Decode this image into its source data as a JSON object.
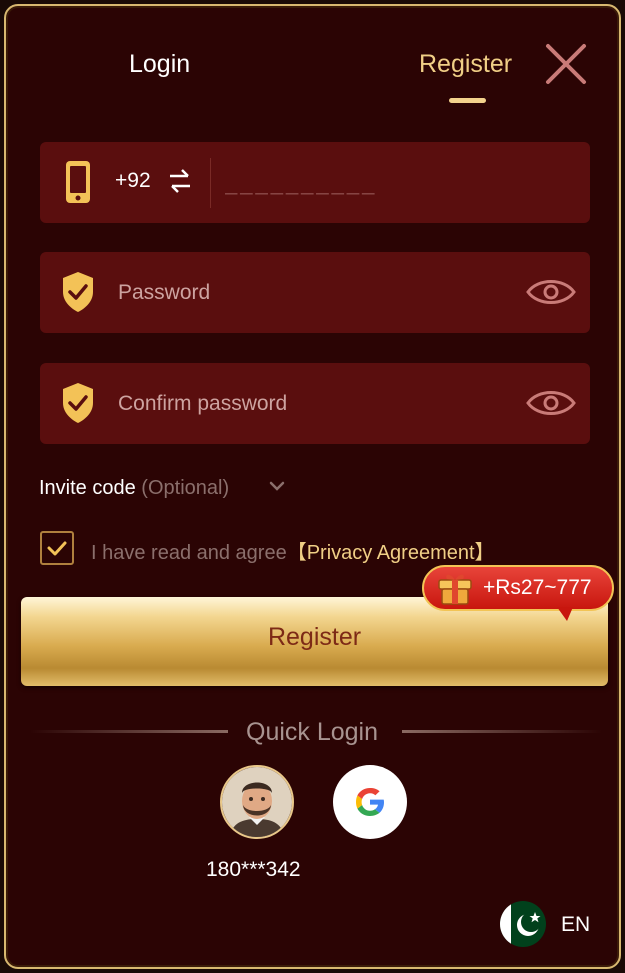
{
  "tabs": {
    "login": "Login",
    "register": "Register",
    "active": "register"
  },
  "icons": {
    "close": "close-icon",
    "phone": "phone-icon",
    "swap": "swap-icon",
    "shield": "shield-check-icon",
    "eye": "eye-icon",
    "chevron": "chevron-down-icon",
    "check": "check-icon",
    "gift": "gift-box-icon",
    "google": "google-icon"
  },
  "phone": {
    "country_code": "+92",
    "placeholder": "__________"
  },
  "password": {
    "placeholder": "Password"
  },
  "confirm_password": {
    "placeholder": "Confirm password"
  },
  "invite": {
    "label": "Invite code",
    "optional": "(Optional)"
  },
  "agreement": {
    "text": "I have read and agree",
    "link": "【Privacy Agreement】",
    "checked": true
  },
  "register_button": {
    "label": "Register"
  },
  "bonus": {
    "text": "+Rs27~777"
  },
  "quick_login": {
    "title": "Quick Login",
    "account": "180***342"
  },
  "language": {
    "code": "EN",
    "flag": "pakistan-flag"
  },
  "colors": {
    "accent_gold": "#f0cf86",
    "panel_bg": "#2b0404",
    "field_bg": "#5a0e0e",
    "bonus_red": "#c8160e"
  }
}
